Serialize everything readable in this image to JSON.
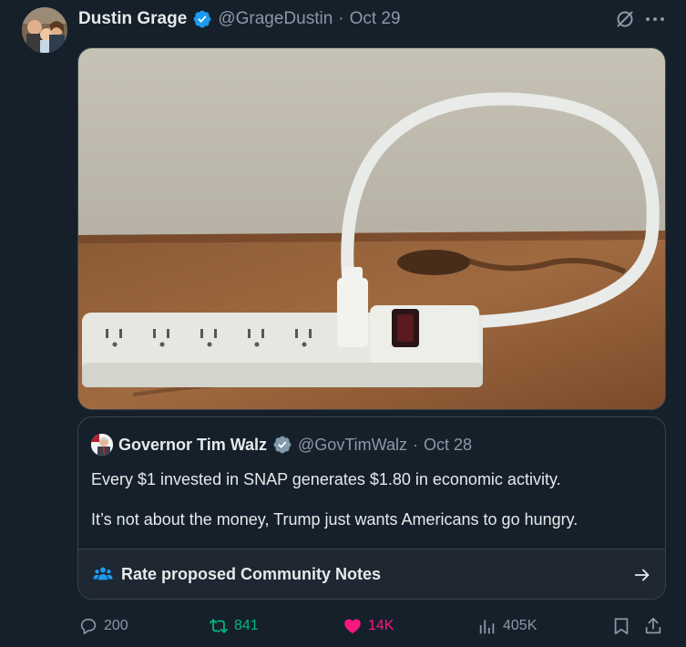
{
  "tweet": {
    "author_name": "Dustin Grage",
    "author_handle": "@GrageDustin",
    "separator": "·",
    "date": "Oct 29",
    "media_alt": "white power strip with a plugged-in cord looping back into itself on a wooden table",
    "icons": {
      "verified": "verified-badge-icon",
      "grok": "grok-icon",
      "more": "more-icon"
    }
  },
  "quote": {
    "author_name": "Governor Tim Walz",
    "author_handle": "@GovTimWalz",
    "separator": "·",
    "date": "Oct 28",
    "text_lines": [
      "Every $1 invested in SNAP generates $1.80 in economic activity.",
      "It’s not about the money, Trump just wants Americans to go hungry."
    ],
    "community_notes_label": "Rate proposed Community Notes"
  },
  "actions": {
    "replies": "200",
    "retweets": "841",
    "likes": "14K",
    "views": "405K"
  },
  "colors": {
    "background": "#15202b",
    "border": "#38444d",
    "text": "#e7e9ea",
    "muted": "#8b98a5",
    "verified": "#1d9bf0",
    "retweet_active": "#00ba7c",
    "like_active": "#f91880",
    "notes_accent": "#1d9bf0"
  }
}
